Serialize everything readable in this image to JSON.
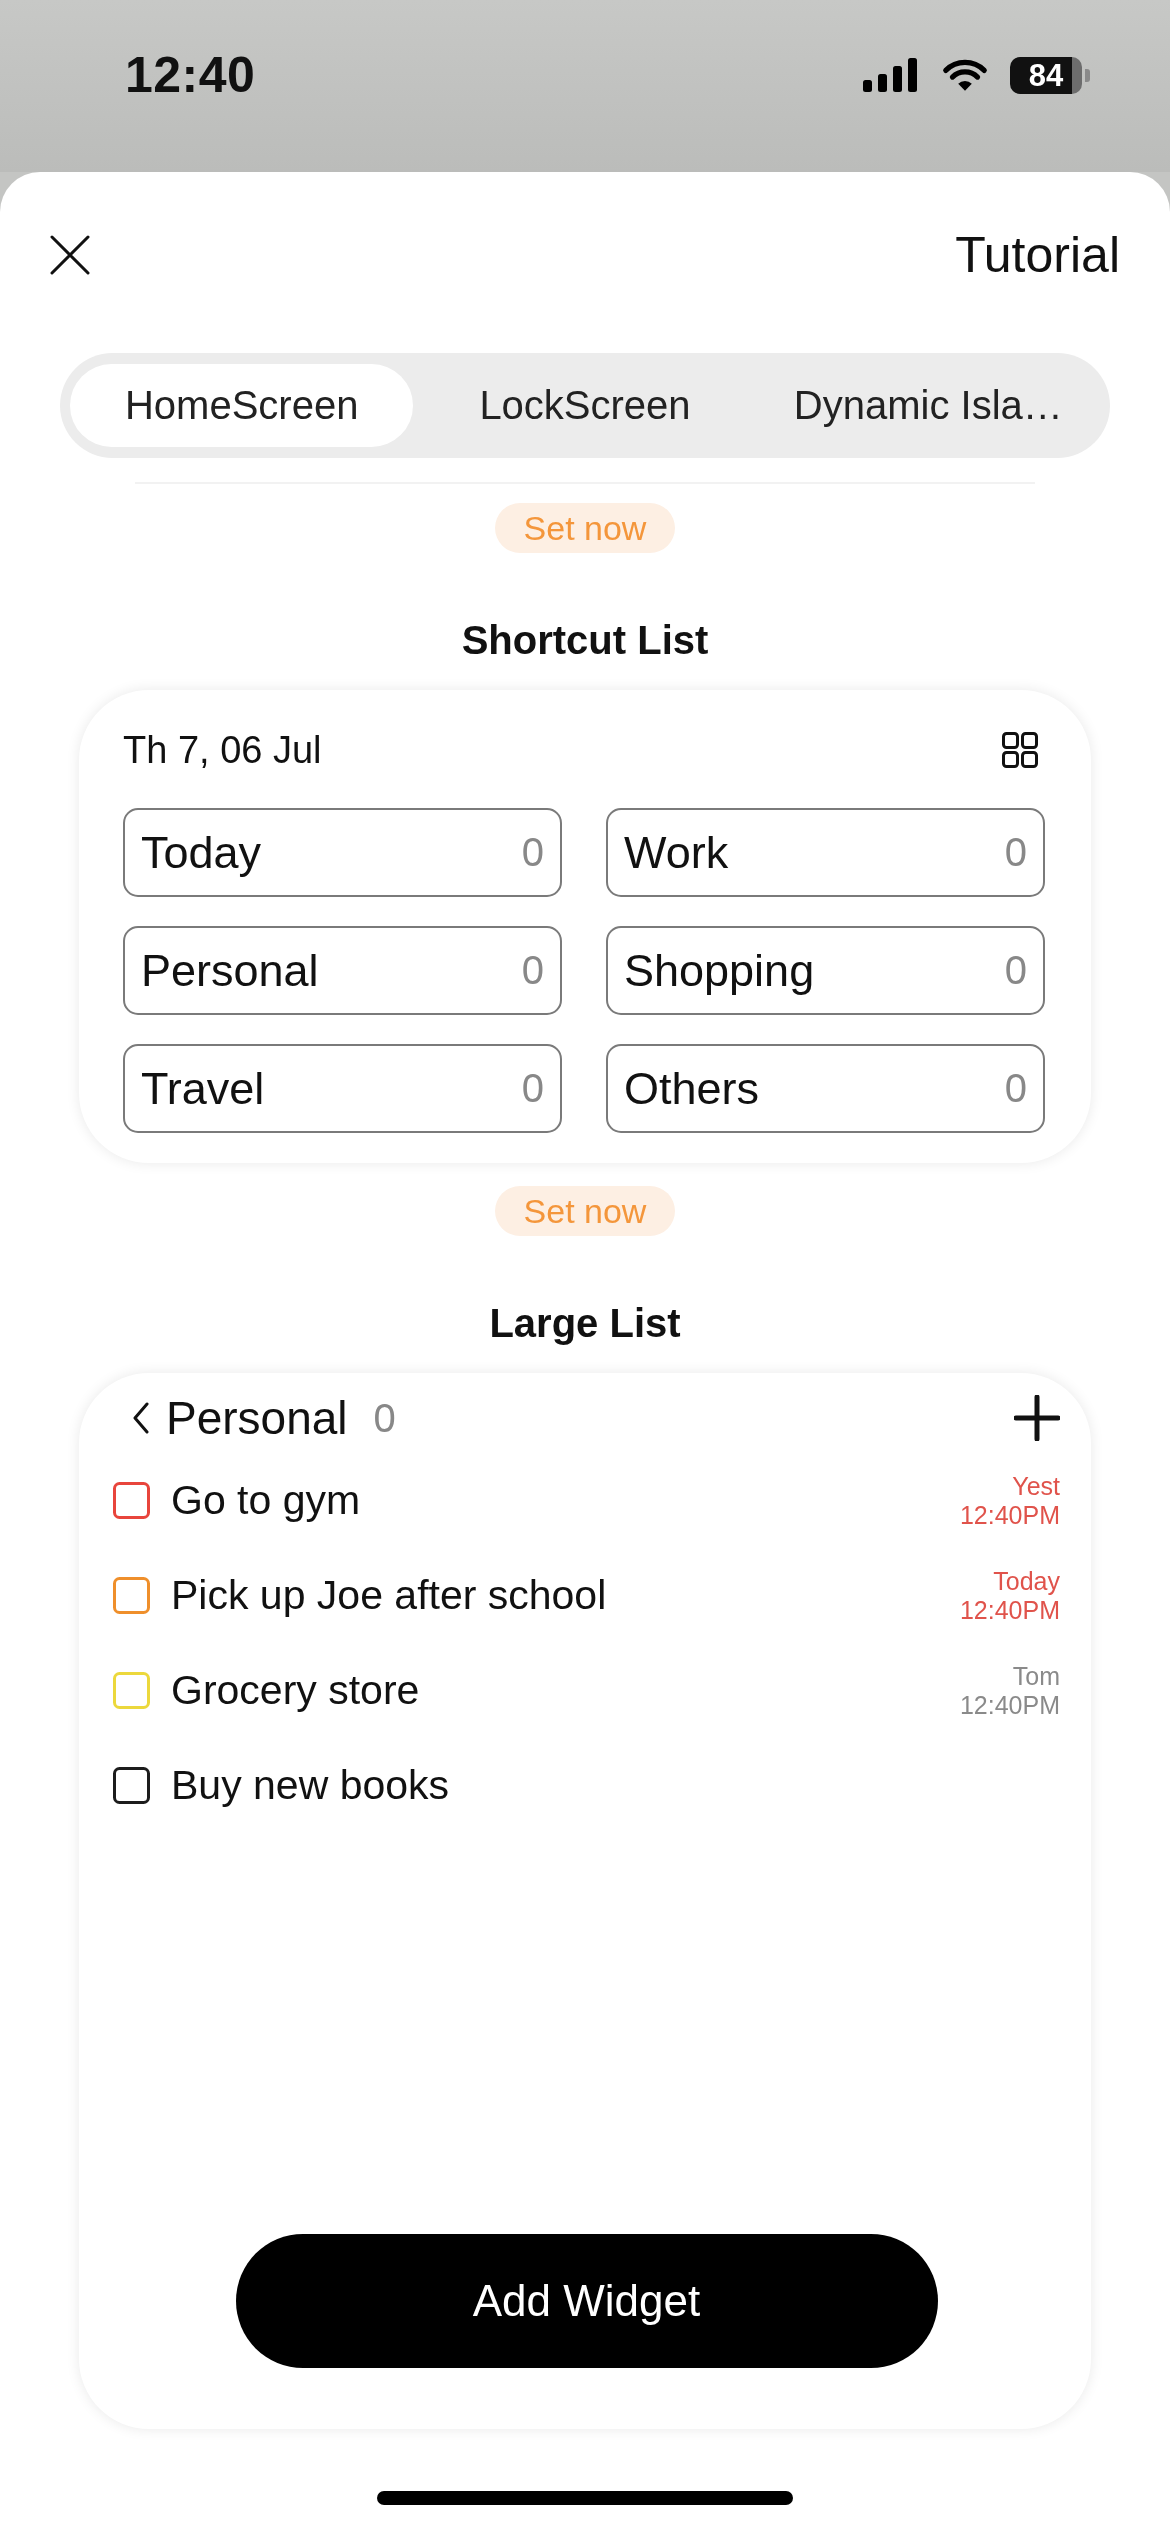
{
  "status_bar": {
    "time": "12:40",
    "battery": "84"
  },
  "header": {
    "title": "Tutorial"
  },
  "tabs": [
    {
      "label": "HomeScreen",
      "selected": true
    },
    {
      "label": "LockScreen",
      "selected": false
    },
    {
      "label": "Dynamic Isla…",
      "selected": false
    }
  ],
  "widgets": [
    {
      "kind": "partial",
      "set_now": "Set now"
    },
    {
      "kind": "shortcut_list",
      "title": "Shortcut List",
      "date": "Th 7, 06 Jul",
      "shortcuts": [
        {
          "label": "Today",
          "count": "0"
        },
        {
          "label": "Work",
          "count": "0"
        },
        {
          "label": "Personal",
          "count": "0"
        },
        {
          "label": "Shopping",
          "count": "0"
        },
        {
          "label": "Travel",
          "count": "0"
        },
        {
          "label": "Others",
          "count": "0"
        }
      ],
      "set_now": "Set now"
    },
    {
      "kind": "large_list",
      "title": "Large List",
      "list_name": "Personal",
      "count": "0",
      "tasks": [
        {
          "text": "Go to gym",
          "checked": false,
          "color": "#e8453c",
          "day": "Yest",
          "time": "12:40PM",
          "urgent": true
        },
        {
          "text": "Pick up Joe after school",
          "checked": false,
          "color": "#ef8f2b",
          "day": "Today",
          "time": "12:40PM",
          "urgent": true
        },
        {
          "text": "Grocery store",
          "checked": false,
          "color": "#ecd83c",
          "day": "Tom",
          "time": "12:40PM",
          "urgent": false
        },
        {
          "text": "Buy new books",
          "checked": false,
          "color": "#1c1c1c"
        }
      ],
      "add_button": "Add Widget"
    }
  ]
}
